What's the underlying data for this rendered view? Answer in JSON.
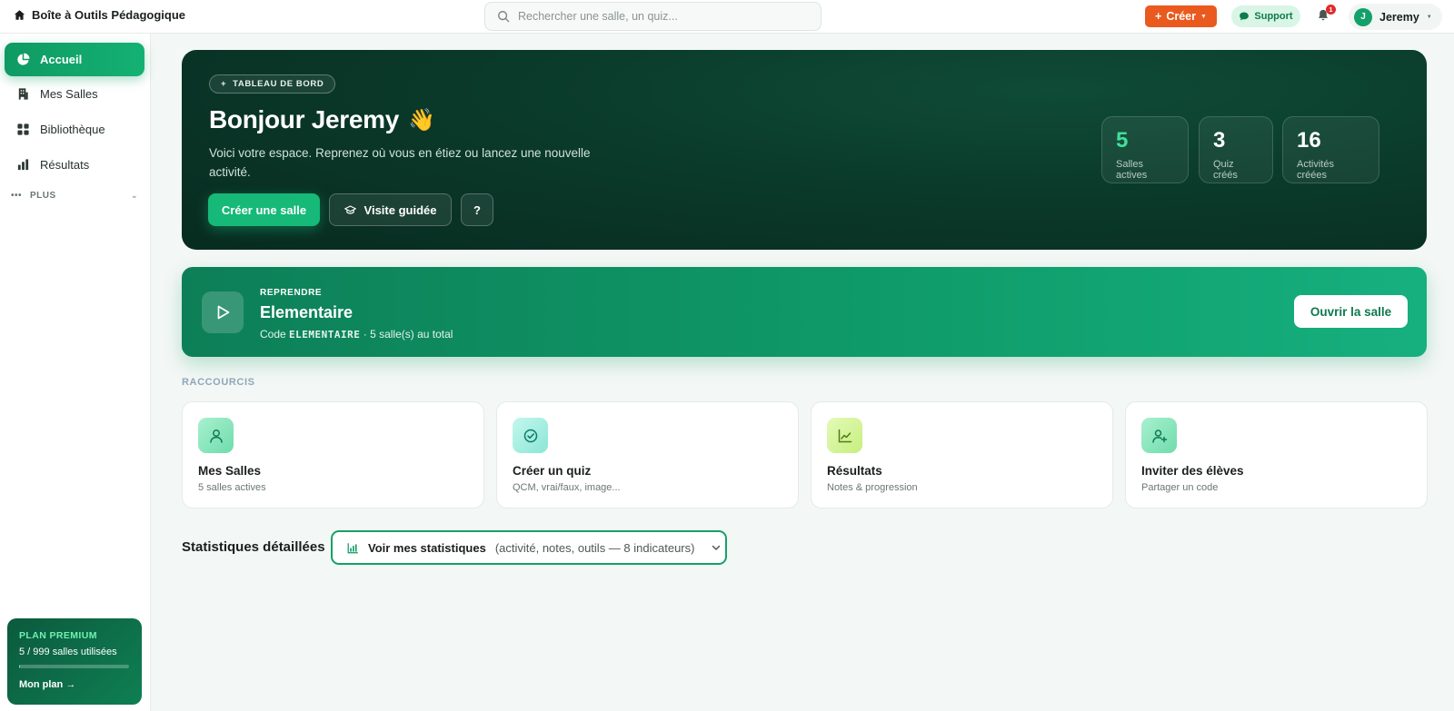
{
  "header": {
    "brand": "Boîte à Outils Pédagogique",
    "search_placeholder": "Rechercher une salle, un quiz...",
    "create_label": "Créer",
    "support_label": "Support",
    "notification_count": "1",
    "user_initial": "J",
    "user_name": "Jeremy"
  },
  "sidebar": {
    "items": [
      {
        "label": "Accueil",
        "icon": "pie-chart-icon",
        "active": true
      },
      {
        "label": "Mes Salles",
        "icon": "building-icon"
      },
      {
        "label": "Bibliothèque",
        "icon": "grid-icon"
      },
      {
        "label": "Résultats",
        "icon": "bar-chart-icon"
      }
    ],
    "more_label": "PLUS",
    "premium": {
      "title": "PLAN PREMIUM",
      "usage": "5 / 999 salles utilisées",
      "usage_fraction": 0.005,
      "link": "Mon plan →"
    }
  },
  "hero": {
    "chip": "TABLEAU DE BORD",
    "title": "Bonjour Jeremy",
    "emoji": "👋",
    "subtitle": "Voici votre espace. Reprenez où vous en étiez ou lancez une nouvelle activité.",
    "create_room": "Créer une salle",
    "guided_tour": "Visite guidée",
    "help": "?",
    "stats": [
      {
        "value": "5",
        "label": "Salles actives"
      },
      {
        "value": "3",
        "label": "Quiz créés"
      },
      {
        "value": "16",
        "label": "Activités créées"
      }
    ]
  },
  "resume": {
    "kicker": "REPRENDRE",
    "title": "Elementaire",
    "code_prefix": "Code",
    "code": "ELEMENTAIRE",
    "code_suffix": "· 5 salle(s) au total",
    "open_button": "Ouvrir la salle"
  },
  "shortcuts": {
    "label": "RACCOURCIS",
    "cards": [
      {
        "title": "Mes Salles",
        "subtitle": "5 salles actives",
        "icon": "user-icon"
      },
      {
        "title": "Créer un quiz",
        "subtitle": "QCM, vrai/faux, image...",
        "icon": "check-circle-icon"
      },
      {
        "title": "Résultats",
        "subtitle": "Notes & progression",
        "icon": "line-chart-icon"
      },
      {
        "title": "Inviter des élèves",
        "subtitle": "Partager un code",
        "icon": "user-plus-icon"
      }
    ]
  },
  "stats_section": {
    "heading": "Statistiques détaillées",
    "toggle_label": "Voir mes statistiques",
    "toggle_detail": "(activité, notes, outils — 8 indicateurs)"
  },
  "colors": {
    "accent": "#13a06a",
    "create": "#ea5a1e",
    "hero_bg": "#0a3a2a"
  }
}
